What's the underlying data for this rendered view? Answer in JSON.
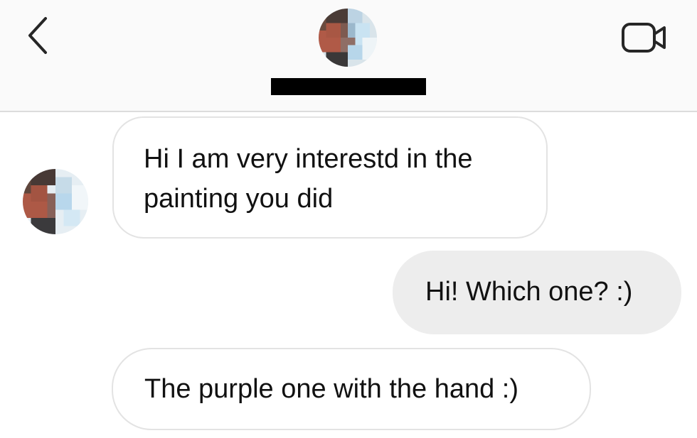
{
  "header": {
    "back_icon": "chevron-left-icon",
    "avatar": "pixelated-avatar",
    "video_icon": "video-camera-icon",
    "colors": {
      "background": "#fafafa",
      "divider": "#dcdcdc",
      "redaction": "#000000"
    }
  },
  "messages": [
    {
      "direction": "incoming",
      "text": "Hi I am very interestd in the\npainting you did"
    },
    {
      "direction": "outgoing",
      "text": "Hi! Which one? :)"
    },
    {
      "direction": "incoming",
      "text": "The purple one with the hand :)"
    }
  ],
  "colors": {
    "incoming_bubble_border": "#e3e3e3",
    "outgoing_bubble_bg": "#ededed",
    "text": "#111111"
  }
}
